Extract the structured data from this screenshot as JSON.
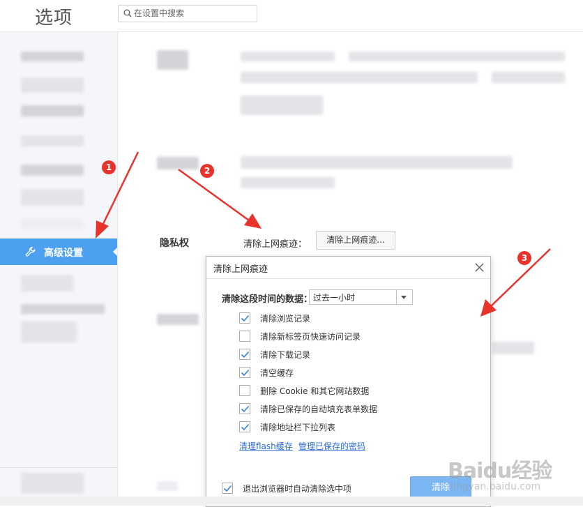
{
  "header": {
    "title": "选项",
    "search_placeholder": "在设置中搜索"
  },
  "sidebar": {
    "active_item_label": "高级设置"
  },
  "privacy": {
    "section_label": "隐私权",
    "clear_trace_label": "清除上网痕迹：",
    "clear_trace_button": "清除上网痕迹..."
  },
  "dialog": {
    "title": "清除上网痕迹",
    "time_range_label": "清除这段时间的数据：",
    "time_range_value": "过去一小时",
    "options": [
      {
        "label": "清除浏览记录",
        "checked": true
      },
      {
        "label": "清除新标签页快速访问记录",
        "checked": false
      },
      {
        "label": "清除下载记录",
        "checked": true
      },
      {
        "label": "清空缓存",
        "checked": true
      },
      {
        "label": "删除 Cookie 和其它网站数据",
        "checked": false
      },
      {
        "label": "清除已保存的自动填充表单数据",
        "checked": true
      },
      {
        "label": "清除地址栏下拉列表",
        "checked": true
      }
    ],
    "link_flash": "清理flash缓存",
    "link_passwords": "管理已保存的密码",
    "auto_clear_label": "退出浏览器时自动清除选中项",
    "auto_clear_checked": true,
    "clear_button": "清除"
  },
  "annotations": {
    "step1": "1",
    "step2": "2",
    "step3": "3",
    "color": "#e8332c"
  },
  "watermark": {
    "main": "Baidu经验",
    "sub": "jingyan.baidu.com"
  },
  "colors": {
    "accent": "#4d9ff0",
    "check": "#3a7fd1",
    "link": "#2c6bd6"
  },
  "icons": {
    "search": "search-icon",
    "advanced": "wrench-icon",
    "close": "close-icon",
    "dropdown": "chevron-down-icon",
    "check": "check-icon"
  }
}
